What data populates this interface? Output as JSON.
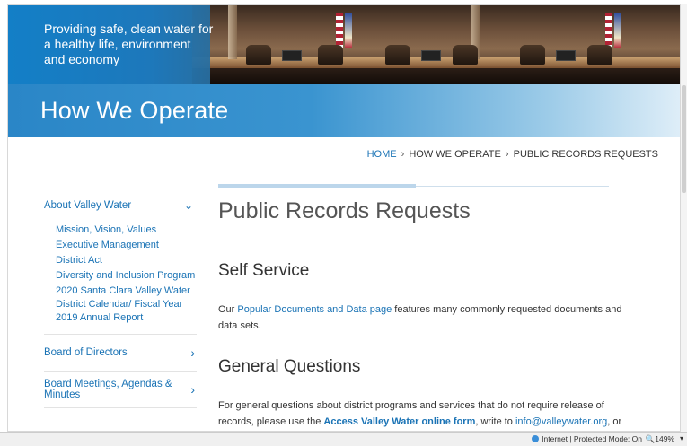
{
  "banner": {
    "tagline": "Providing safe, clean water for a healthy life, environment and economy"
  },
  "page_heading": "How We Operate",
  "breadcrumb": {
    "home": "HOME",
    "separator": "›",
    "section": "HOW WE OPERATE",
    "current": "PUBLIC RECORDS REQUESTS"
  },
  "sidebar": {
    "about": {
      "label": "About Valley Water",
      "children": [
        "Mission, Vision, Values",
        "Executive Management",
        "District Act",
        "Diversity and Inclusion Program",
        "2020 Santa Clara Valley Water District Calendar/ Fiscal Year 2019 Annual Report"
      ]
    },
    "items": [
      "Board of Directors",
      "Board Meetings, Agendas & Minutes"
    ]
  },
  "main": {
    "title": "Public Records Requests",
    "self_service": {
      "heading": "Self Service",
      "text_before": "Our ",
      "link": "Popular Documents and Data page",
      "text_after": " features many commonly requested documents and data sets."
    },
    "general": {
      "heading": "General Questions",
      "text1": "For general questions about district programs and services that do not require release of records, please use the ",
      "link1": "Access Valley Water online form",
      "text2": ", write to ",
      "link2": "info@valleywater.org",
      "text3": ", or call the district"
    }
  },
  "statusbar": {
    "mode": "Internet | Protected Mode: On",
    "zoom": "149%"
  },
  "colors": {
    "link": "#1a73b5",
    "banner_blue": "#2a86c7"
  }
}
